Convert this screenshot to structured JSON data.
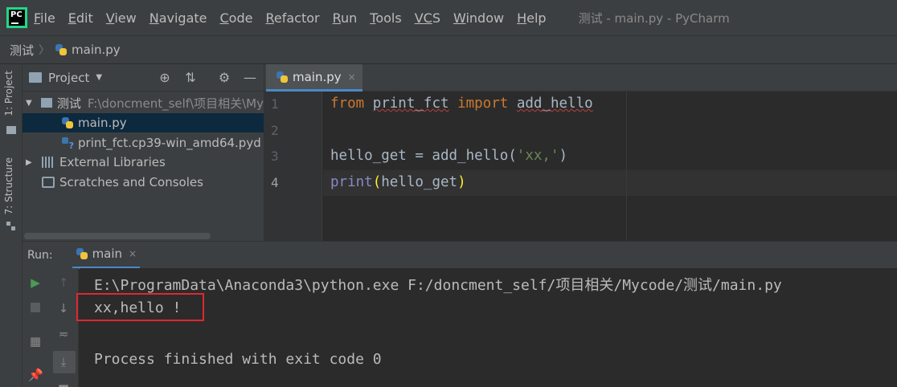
{
  "app": {
    "logo_text": "PC",
    "window_title": "测试 - main.py - PyCharm"
  },
  "menu": {
    "items": [
      {
        "first": "F",
        "rest": "ile"
      },
      {
        "first": "E",
        "rest": "dit"
      },
      {
        "first": "V",
        "rest": "iew"
      },
      {
        "first": "N",
        "rest": "avigate"
      },
      {
        "first": "C",
        "rest": "ode"
      },
      {
        "first": "R",
        "rest": "efactor"
      },
      {
        "first": "R",
        "rest": "un"
      },
      {
        "first": "T",
        "rest": "ools"
      },
      {
        "first": "VC",
        "rest": "S"
      },
      {
        "first": "W",
        "rest": "indow"
      },
      {
        "first": "H",
        "rest": "elp"
      }
    ]
  },
  "breadcrumb": {
    "project": "测试",
    "file": "main.py"
  },
  "sidebar_strip": {
    "project_tab": "1: Project",
    "structure_tab": "7: Structure"
  },
  "project_panel": {
    "title": "Project",
    "tree": {
      "root_name": "测试",
      "root_path": "F:\\doncment_self\\项目相关\\My",
      "main_file": "main.py",
      "pyd_file": "print_fct.cp39-win_amd64.pyd",
      "external_libraries": "External Libraries",
      "scratches": "Scratches and Consoles"
    }
  },
  "editor": {
    "tab_label": "main.py",
    "tab_close": "×",
    "line_numbers": [
      "1",
      "2",
      "3",
      "4"
    ],
    "code": {
      "line1_from": "from",
      "line1_module": "print_fct",
      "line1_import": "import",
      "line1_name": "add_hello",
      "line3_var": "hello_get = add_hello(",
      "line3_str": "'xx,'",
      "line3_close": ")",
      "line4_print": "print",
      "line4_open": "(",
      "line4_arg": "hello_get",
      "line4_close": ")"
    }
  },
  "run_panel": {
    "label": "Run:",
    "tab_label": "main",
    "tab_close": "×",
    "output": [
      "E:\\ProgramData\\Anaconda3\\python.exe F:/doncment_self/项目相关/Mycode/测试/main.py",
      "xx,hello !",
      "",
      "Process finished with exit code 0"
    ]
  },
  "colors": {
    "background": "#2b2b2b",
    "panel": "#3c3f41",
    "keyword": "#cc7832",
    "string": "#6a8759",
    "builtin": "#8888c6",
    "highlight_box": "#e0282e",
    "run_green": "#499c54",
    "selection": "#0d293e"
  },
  "icons": {
    "run": "play-icon",
    "stop": "stop-icon",
    "up": "arrow-up-icon",
    "down": "arrow-down-icon",
    "target": "locate-icon",
    "collapse": "collapse-icon",
    "settings": "gear-icon",
    "hide": "minimize-icon",
    "pin": "pin-icon"
  }
}
